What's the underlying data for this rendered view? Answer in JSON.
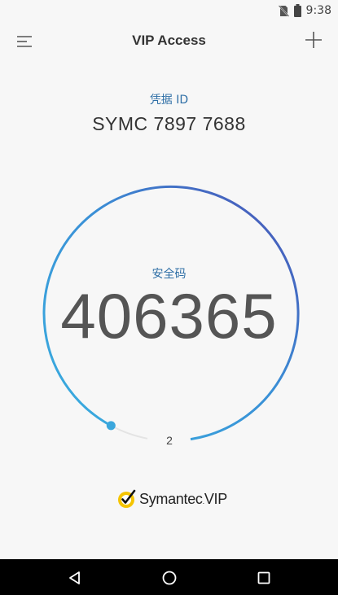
{
  "status_bar": {
    "time": "9:38",
    "icons": [
      "no-sim-icon",
      "battery-icon"
    ]
  },
  "app_bar": {
    "title": "VIP Access",
    "menu_icon": "menu-icon",
    "add_icon": "plus-icon"
  },
  "credential": {
    "label": "凭据 ID",
    "id": "SYMC 7897 7688"
  },
  "security_code": {
    "label": "安全码",
    "code": "406365",
    "countdown": "2",
    "ring_colors": [
      "#3aa6dc",
      "#4a4fb5"
    ]
  },
  "brand": {
    "name": "Symantec",
    "suffix": "VIP",
    "check_color": "#f5c400"
  },
  "nav_bar": {
    "buttons": [
      "back-icon",
      "home-icon",
      "recents-icon"
    ]
  }
}
